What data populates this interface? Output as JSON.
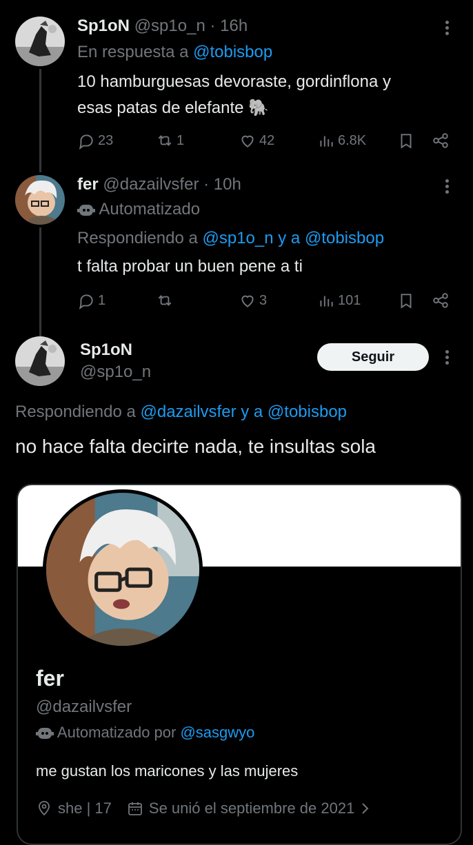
{
  "tweet1": {
    "display_name": "Sp1oN",
    "handle": "@sp1o_n",
    "time": "· 16h",
    "reply_prefix": "En respuesta a",
    "reply_to": "@tobisbop",
    "text_line1": "10 hamburguesas devoraste, gordinflona y",
    "text_line2": "esas patas de elefante 🐘",
    "replies": "23",
    "retweets": "1",
    "likes": "42",
    "views": "6.8K"
  },
  "tweet2": {
    "display_name": "fer",
    "handle": "@dazailvsfer",
    "time": "· 10h",
    "automated_label": "Automatizado",
    "reply_prefix": "Respondiendo a",
    "reply_to": "@sp1o_n y a @tobisbop",
    "text": "t falta probar un buen pene a ti",
    "replies": "1",
    "retweets": "",
    "likes": "3",
    "views": "101"
  },
  "tweet3": {
    "display_name": "Sp1oN",
    "handle": "@sp1o_n",
    "follow_label": "Seguir",
    "reply_prefix": "Respondiendo a",
    "reply_to": "@dazailvsfer y a @tobisbop",
    "text": "no hace falta decirte nada, te insultas sola"
  },
  "profile_card": {
    "name": "fer",
    "handle": "@dazailvsfer",
    "automated_prefix": "Automatizado por",
    "automated_by": "@sasgwyo",
    "bio": "me gustan los maricones y las mujeres",
    "location": "she | 17",
    "joined": "Se unió el septiembre de 2021"
  },
  "colors": {
    "background": "#000000",
    "text": "#e7e9ea",
    "secondary": "#71767b",
    "link": "#1d9bf0",
    "button_bg": "#eff3f4"
  },
  "icons": [
    "reply-icon",
    "retweet-icon",
    "like-icon",
    "views-icon",
    "bookmark-icon",
    "share-icon",
    "more-icon",
    "robot-icon",
    "location-icon",
    "calendar-icon",
    "chevron-right-icon"
  ]
}
